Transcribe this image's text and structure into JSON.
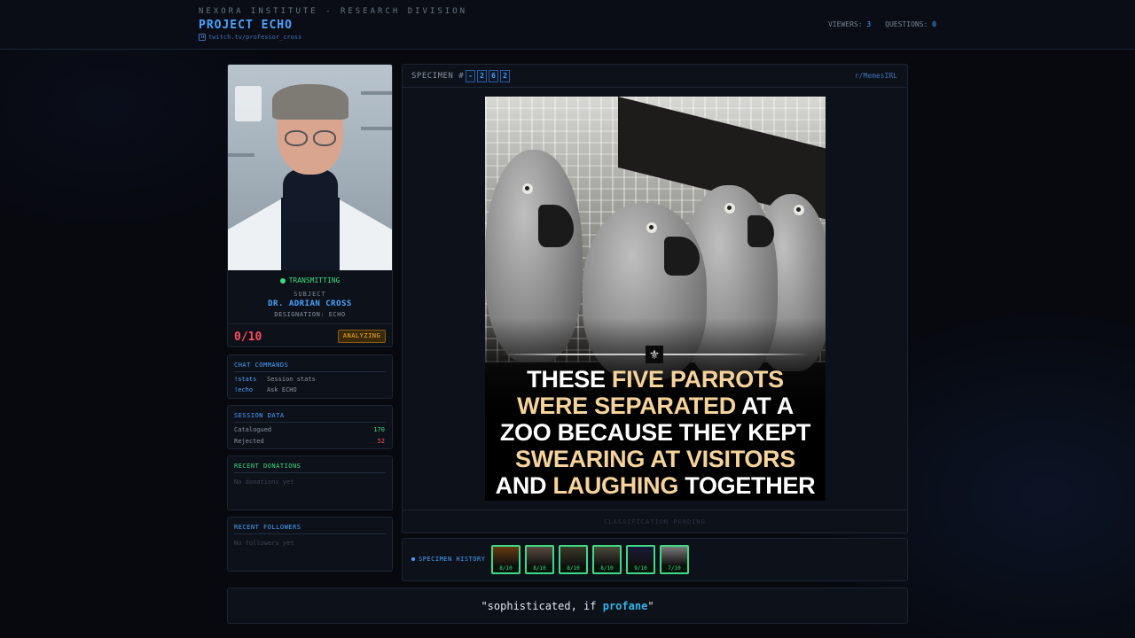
{
  "header": {
    "org": "NEXORA INSTITUTE - RESEARCH DIVISION",
    "project": "PROJECT ECHO",
    "link": "twitch.tv/professor_cross",
    "viewers_label": "VIEWERS:",
    "viewers": "3",
    "questions_label": "QUESTIONS:",
    "questions": "0"
  },
  "profile": {
    "status": "TRANSMITTING",
    "subject_label": "SUBJECT",
    "name": "DR. ADRIAN CROSS",
    "designation": "DESIGNATION: ECHO",
    "score": "0/10",
    "badge": "ANALYZING"
  },
  "commands": {
    "title": "CHAT COMMANDS",
    "items": [
      {
        "key": "!stats",
        "desc": "Session stats"
      },
      {
        "key": "!echo",
        "desc": "Ask ECHO"
      }
    ]
  },
  "session": {
    "title": "SESSION DATA",
    "catalogued_label": "Catalogued",
    "catalogued": "170",
    "rejected_label": "Rejected",
    "rejected": "52"
  },
  "donations": {
    "title": "RECENT DONATIONS",
    "empty": "No donations yet"
  },
  "followers": {
    "title": "RECENT FOLLOWERS",
    "empty": "No followers yet"
  },
  "specimen": {
    "label": "SPECIMEN #",
    "digits": [
      "-",
      "2",
      "6",
      "2"
    ],
    "subreddit": "r/MemesIRL",
    "footer": "CLASSIFICATION PENDING",
    "caption": {
      "l1a": "THESE ",
      "l1b": "FIVE PARROTS",
      "l2a": "WERE SEPARATED",
      "l2b": " AT A",
      "l3": "ZOO BECAUSE THEY KEPT",
      "l4": "SWEARING AT VISITORS",
      "l5a": "AND ",
      "l5b": "LAUGHING",
      "l5c": " TOGETHER"
    }
  },
  "history": {
    "label": "SPECIMEN HISTORY",
    "thumbs": [
      {
        "score": "8/10",
        "color": "#6a3a12"
      },
      {
        "score": "8/10",
        "color": "#5a4a40"
      },
      {
        "score": "8/10",
        "color": "#3a3a2a"
      },
      {
        "score": "8/10",
        "color": "#4a4a3a"
      },
      {
        "score": "9/10",
        "color": "#1a1a3a"
      },
      {
        "score": "7/10",
        "color": "#7a7a7a"
      }
    ]
  },
  "quote": {
    "pre": "\"sophisticated, if ",
    "accent": "profane",
    "post": "\""
  }
}
